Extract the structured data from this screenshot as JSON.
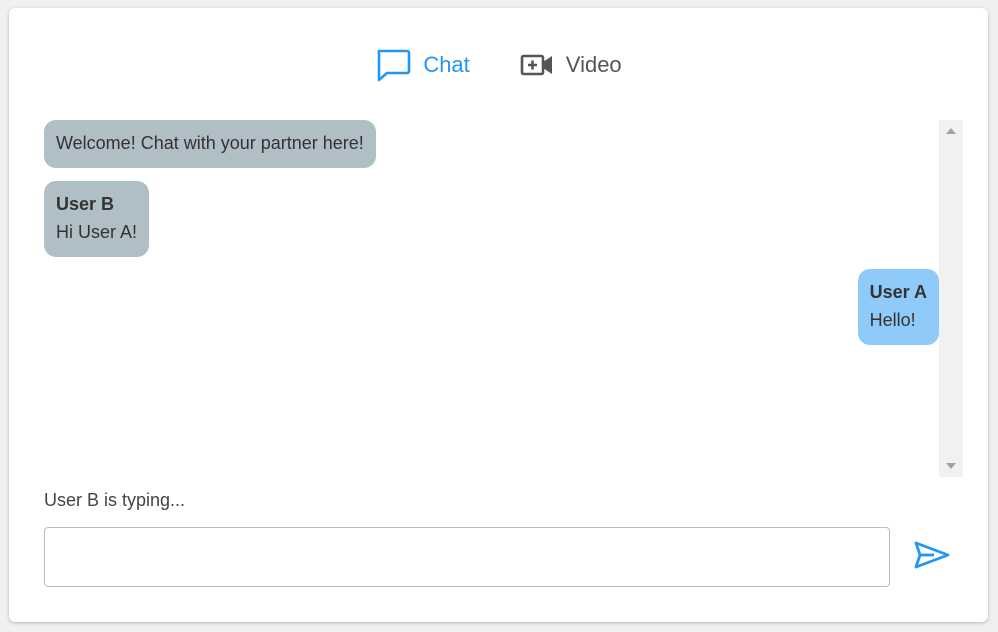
{
  "tabs": [
    {
      "label": "Chat",
      "icon": "chat-bubble-icon",
      "active": true
    },
    {
      "label": "Video",
      "icon": "video-camera-icon",
      "active": false
    }
  ],
  "messages": [
    {
      "type": "system",
      "text": "Welcome! Chat with your partner here!"
    },
    {
      "type": "other",
      "author": "User B",
      "text": "Hi User A!"
    },
    {
      "type": "mine",
      "author": "User A",
      "text": "Hello!"
    }
  ],
  "status": {
    "typing": "User B is typing..."
  },
  "composer": {
    "placeholder": "",
    "value": "",
    "send_icon": "send-icon"
  },
  "colors": {
    "accent": "#2196f3",
    "other_bubble": "#b0bec5",
    "mine_bubble": "#90caf9"
  }
}
